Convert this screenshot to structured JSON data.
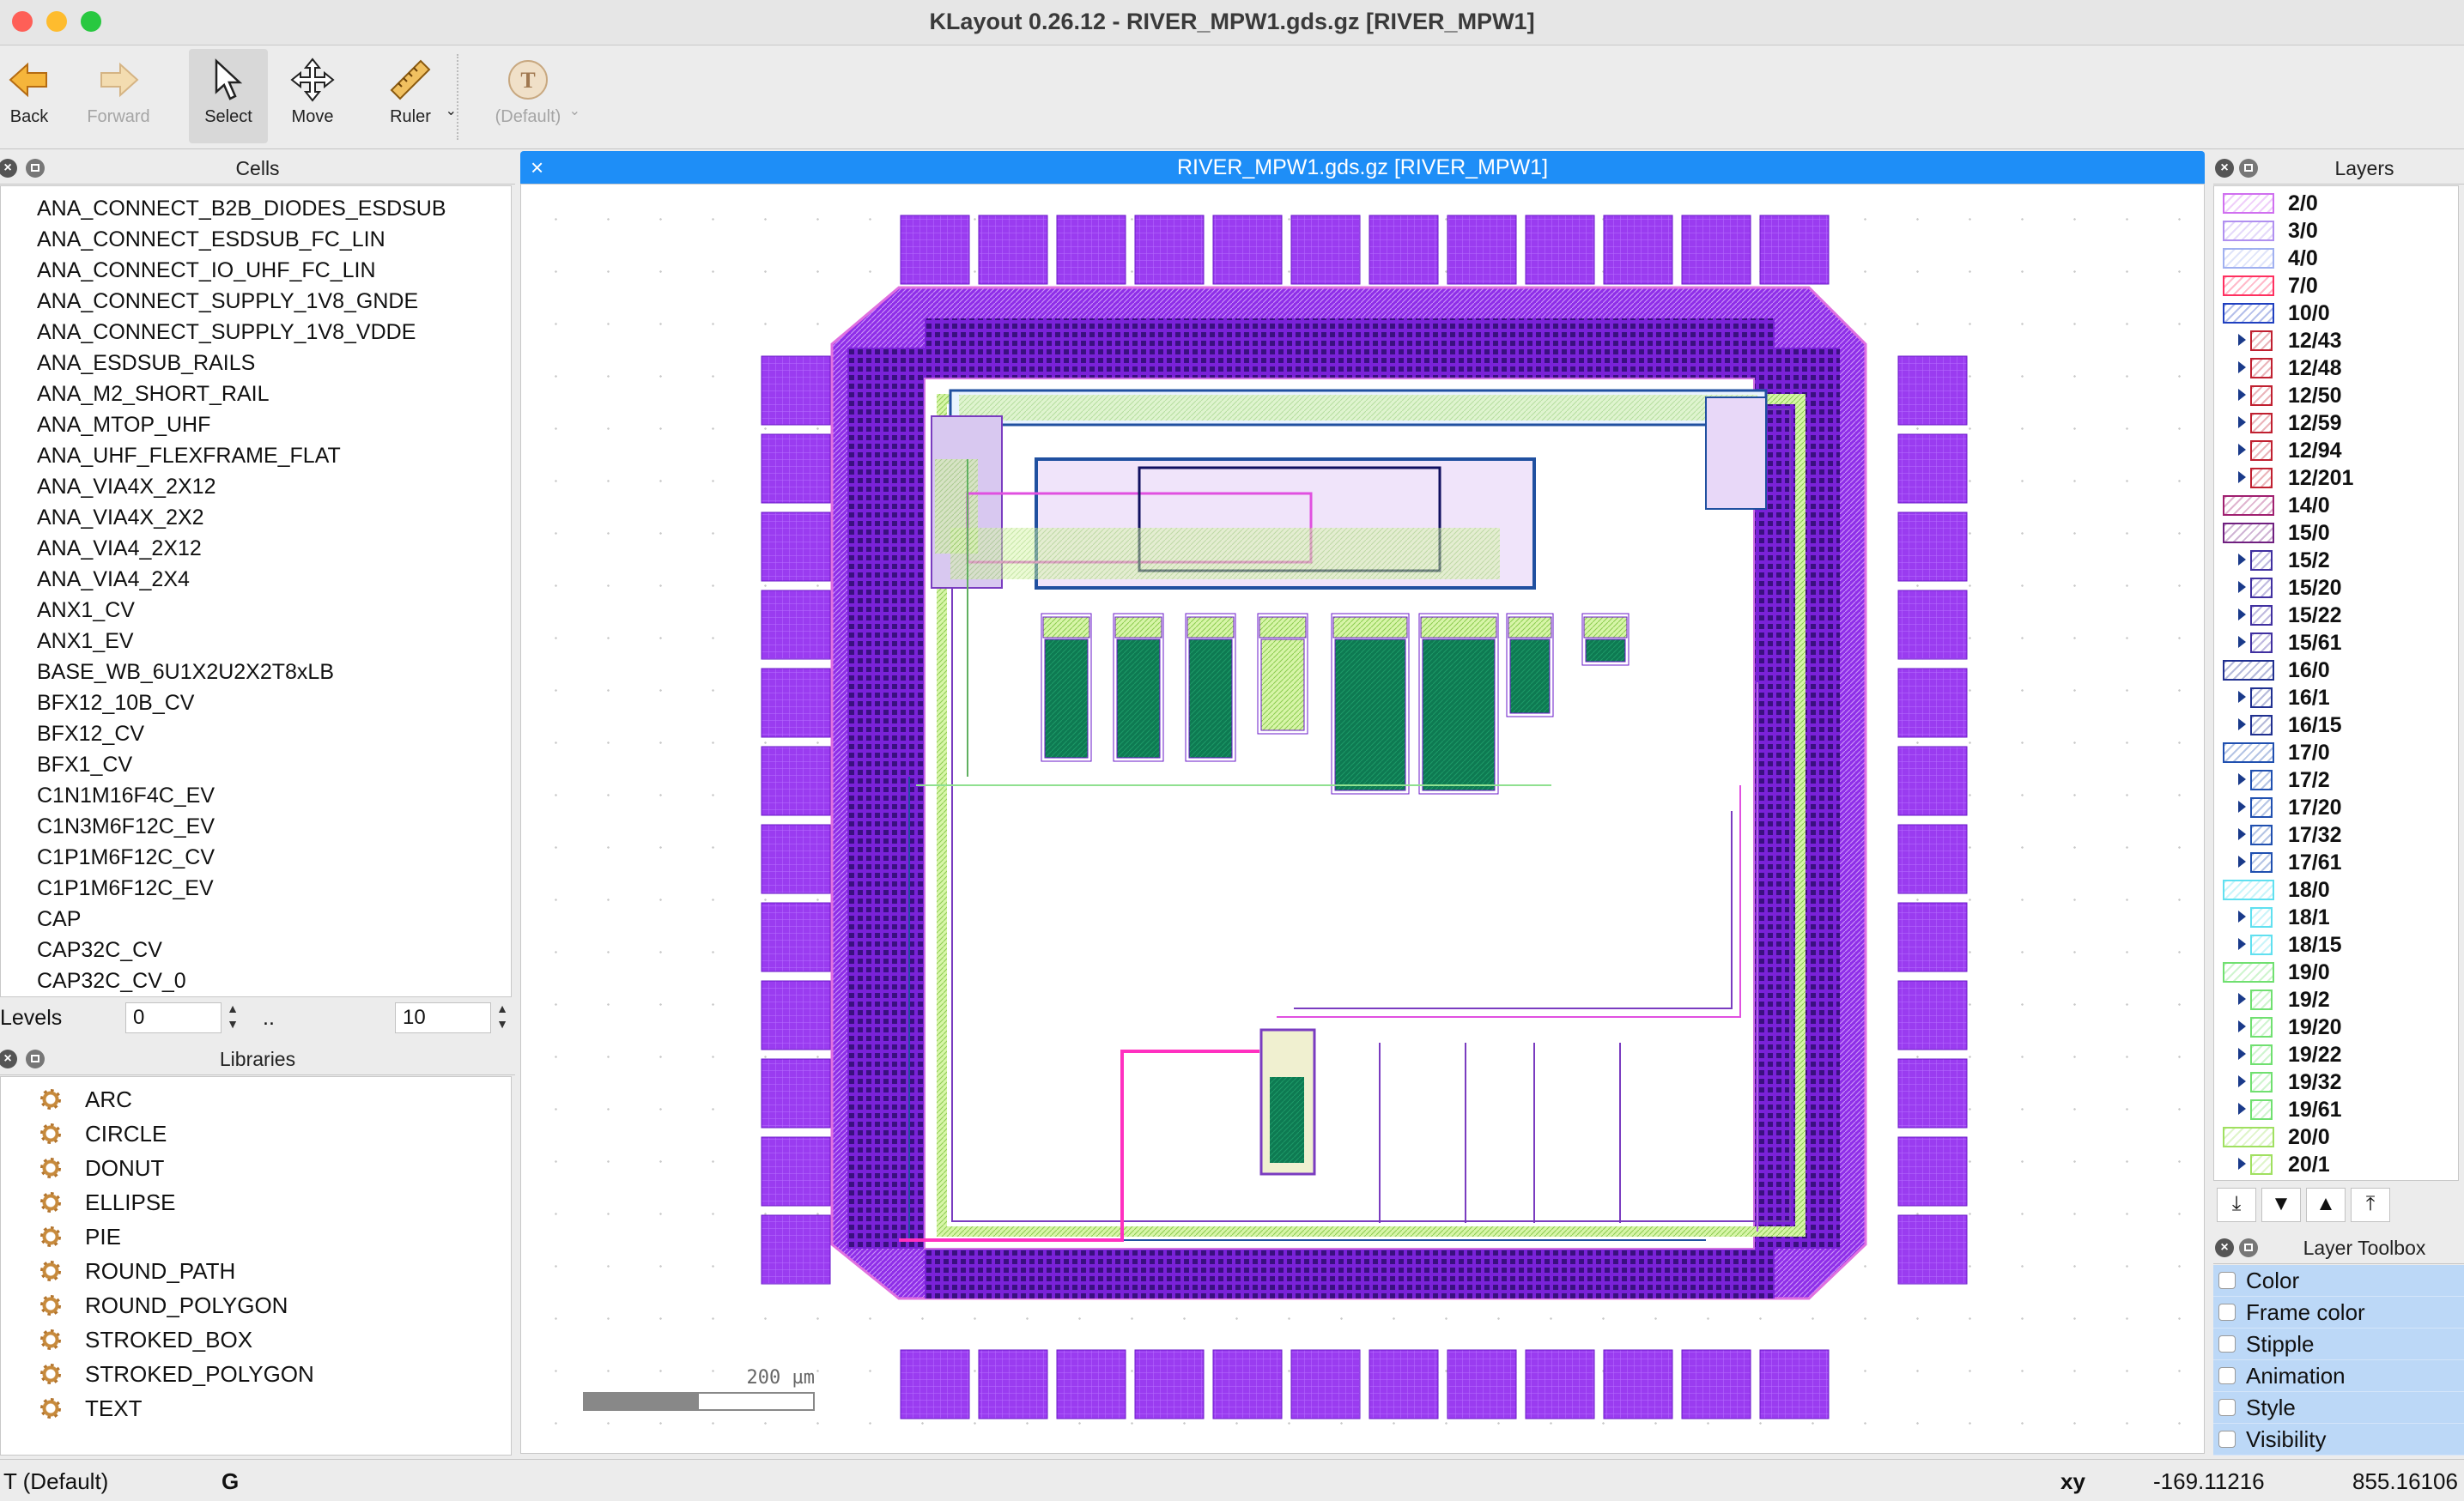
{
  "window": {
    "title": "KLayout 0.26.12 - RIVER_MPW1.gds.gz [RIVER_MPW1]"
  },
  "toolbar": {
    "back": "Back",
    "forward": "Forward",
    "select": "Select",
    "move": "Move",
    "ruler": "Ruler",
    "text_mode": "(Default)"
  },
  "cells_panel": {
    "title": "Cells",
    "items": [
      "ANA_CONNECT_B2B_DIODES_ESDSUB",
      "ANA_CONNECT_ESDSUB_FC_LIN",
      "ANA_CONNECT_IO_UHF_FC_LIN",
      "ANA_CONNECT_SUPPLY_1V8_GNDE",
      "ANA_CONNECT_SUPPLY_1V8_VDDE",
      "ANA_ESDSUB_RAILS",
      "ANA_M2_SHORT_RAIL",
      "ANA_MTOP_UHF",
      "ANA_UHF_FLEXFRAME_FLAT",
      "ANA_VIA4X_2X12",
      "ANA_VIA4X_2X2",
      "ANA_VIA4_2X12",
      "ANA_VIA4_2X4",
      "ANX1_CV",
      "ANX1_EV",
      "BASE_WB_6U1X2U2X2T8xLB",
      "BFX12_10B_CV",
      "BFX12_CV",
      "BFX1_CV",
      "C1N1M16F4C_EV",
      "C1N3M6F12C_EV",
      "C1P1M6F12C_CV",
      "C1P1M6F12C_EV",
      "CAP",
      "CAP32C_CV",
      "CAP32C_CV_0"
    ]
  },
  "levels": {
    "label": "Levels",
    "from": "0",
    "sep": "..",
    "to": "10"
  },
  "libraries_panel": {
    "title": "Libraries",
    "items": [
      "ARC",
      "CIRCLE",
      "DONUT",
      "ELLIPSE",
      "PIE",
      "ROUND_PATH",
      "ROUND_POLYGON",
      "STROKED_BOX",
      "STROKED_POLYGON",
      "TEXT"
    ]
  },
  "canvas": {
    "tab_title": "RIVER_MPW1.gds.gz [RIVER_MPW1]",
    "scale_label": "200 µm"
  },
  "layers_panel": {
    "title": "Layers",
    "items": [
      {
        "name": "2/0",
        "color": "#d070f0",
        "sub": false
      },
      {
        "name": "3/0",
        "color": "#b090f0",
        "sub": false
      },
      {
        "name": "4/0",
        "color": "#a0b0f0",
        "sub": false
      },
      {
        "name": "7/0",
        "color": "#ff3060",
        "sub": false
      },
      {
        "name": "10/0",
        "color": "#2040c0",
        "sub": false
      },
      {
        "name": "12/43",
        "color": "#c02030",
        "sub": true
      },
      {
        "name": "12/48",
        "color": "#c02030",
        "sub": true
      },
      {
        "name": "12/50",
        "color": "#c02030",
        "sub": true
      },
      {
        "name": "12/59",
        "color": "#c02030",
        "sub": true
      },
      {
        "name": "12/94",
        "color": "#c02030",
        "sub": true
      },
      {
        "name": "12/201",
        "color": "#c02030",
        "sub": true
      },
      {
        "name": "14/0",
        "color": "#a02070",
        "sub": false
      },
      {
        "name": "15/0",
        "color": "#702080",
        "sub": false
      },
      {
        "name": "15/2",
        "color": "#4030a0",
        "sub": true
      },
      {
        "name": "15/20",
        "color": "#4030a0",
        "sub": true
      },
      {
        "name": "15/22",
        "color": "#4030a0",
        "sub": true
      },
      {
        "name": "15/61",
        "color": "#4030a0",
        "sub": true
      },
      {
        "name": "16/0",
        "color": "#203090",
        "sub": false
      },
      {
        "name": "16/1",
        "color": "#203090",
        "sub": true
      },
      {
        "name": "16/15",
        "color": "#203090",
        "sub": true
      },
      {
        "name": "17/0",
        "color": "#2050b0",
        "sub": false
      },
      {
        "name": "17/2",
        "color": "#2050b0",
        "sub": true
      },
      {
        "name": "17/20",
        "color": "#2050b0",
        "sub": true
      },
      {
        "name": "17/32",
        "color": "#2050b0",
        "sub": true
      },
      {
        "name": "17/61",
        "color": "#2050b0",
        "sub": true
      },
      {
        "name": "18/0",
        "color": "#60e0f0",
        "sub": false
      },
      {
        "name": "18/1",
        "color": "#60e0f0",
        "sub": true
      },
      {
        "name": "18/15",
        "color": "#60e0f0",
        "sub": true
      },
      {
        "name": "19/0",
        "color": "#70e070",
        "sub": false
      },
      {
        "name": "19/2",
        "color": "#70e070",
        "sub": true
      },
      {
        "name": "19/20",
        "color": "#70e070",
        "sub": true
      },
      {
        "name": "19/22",
        "color": "#70e070",
        "sub": true
      },
      {
        "name": "19/32",
        "color": "#70e070",
        "sub": true
      },
      {
        "name": "19/61",
        "color": "#70e070",
        "sub": true
      },
      {
        "name": "20/0",
        "color": "#a0e060",
        "sub": false
      },
      {
        "name": "20/1",
        "color": "#a0e060",
        "sub": true
      }
    ]
  },
  "layer_toolbox": {
    "title": "Layer Toolbox",
    "items": [
      "Color",
      "Frame color",
      "Stipple",
      "Animation",
      "Style",
      "Visibility"
    ]
  },
  "status_bar": {
    "mode": "T  (Default)",
    "grid": "G",
    "coord_label": "xy",
    "x": "-169.11216",
    "y": "855.16106"
  },
  "colors": {
    "pad": "#9a3cf0",
    "ring": "#8a28e8",
    "tab": "#1e8ef7",
    "toolbox_row": "#bcd8f7"
  }
}
